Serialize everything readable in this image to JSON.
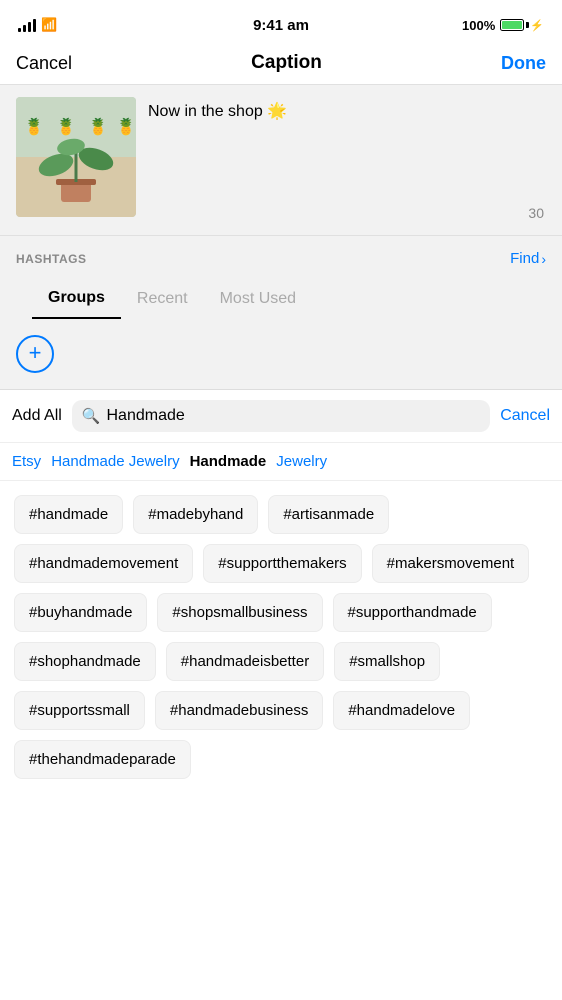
{
  "statusBar": {
    "time": "9:41 am",
    "battery": "100%"
  },
  "nav": {
    "cancel": "Cancel",
    "title": "Caption",
    "done": "Done"
  },
  "caption": {
    "text": "Now in the shop 🌟",
    "charCount": "30"
  },
  "hashtags": {
    "label": "HASHTAGS",
    "find": "Find"
  },
  "tabs": [
    {
      "label": "Groups",
      "active": true
    },
    {
      "label": "Recent",
      "active": false
    },
    {
      "label": "Most Used",
      "active": false
    }
  ],
  "searchBar": {
    "value": "Handmade",
    "placeholder": "Search"
  },
  "addAll": "Add All",
  "cancelSearch": "Cancel",
  "tagChips": [
    {
      "label": "Etsy",
      "active": false
    },
    {
      "label": "Handmade Jewelry",
      "active": false
    },
    {
      "label": "Handmade",
      "active": true
    },
    {
      "label": "Jewelry",
      "active": false
    }
  ],
  "hashtags_list": [
    "#handmade",
    "#madebyhand",
    "#artisanmade",
    "#handmademovement",
    "#supportthemakers",
    "#makersmovement",
    "#buyhandmade",
    "#shopsmallbusiness",
    "#supporthandmade",
    "#shophandmade",
    "#handmadeisbetter",
    "#smallshop",
    "#supportssmall",
    "#handmadebusiness",
    "#handmadelove",
    "#thehandmadeparade"
  ]
}
